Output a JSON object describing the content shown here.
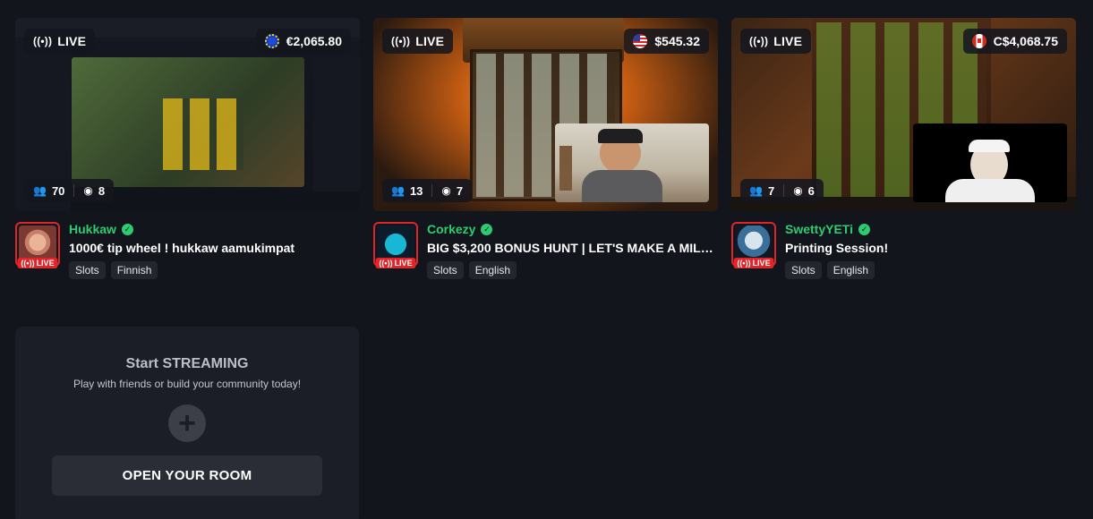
{
  "streams": [
    {
      "live_label": "LIVE",
      "balance": "€2,065.80",
      "flag_icon": "eu-flag-icon",
      "players": "70",
      "viewers": "8",
      "streamer": "Hukkaw",
      "title": "1000€ tip wheel ! hukkaw aamukimpat",
      "tags": [
        "Slots",
        "Finnish"
      ],
      "avatar_live": "LIVE"
    },
    {
      "live_label": "LIVE",
      "balance": "$545.32",
      "flag_icon": "us-flag-icon",
      "players": "13",
      "viewers": "7",
      "streamer": "Corkezy",
      "title": "BIG $3,200 BONUS HUNT | LET'S MAKE A MILLI...",
      "tags": [
        "Slots",
        "English"
      ],
      "avatar_live": "LIVE"
    },
    {
      "live_label": "LIVE",
      "balance": "C$4,068.75",
      "flag_icon": "canada-flag-icon",
      "players": "7",
      "viewers": "6",
      "streamer": "SwettyYETi",
      "title": "Printing Session!",
      "tags": [
        "Slots",
        "English"
      ],
      "avatar_live": "LIVE"
    }
  ],
  "start_streaming": {
    "title": "Start STREAMING",
    "subtitle": "Play with friends or build your community today!",
    "button": "OPEN YOUR ROOM"
  },
  "colors": {
    "background": "#13151c",
    "accent_green": "#2ecc71",
    "live_red": "#e0252a"
  }
}
